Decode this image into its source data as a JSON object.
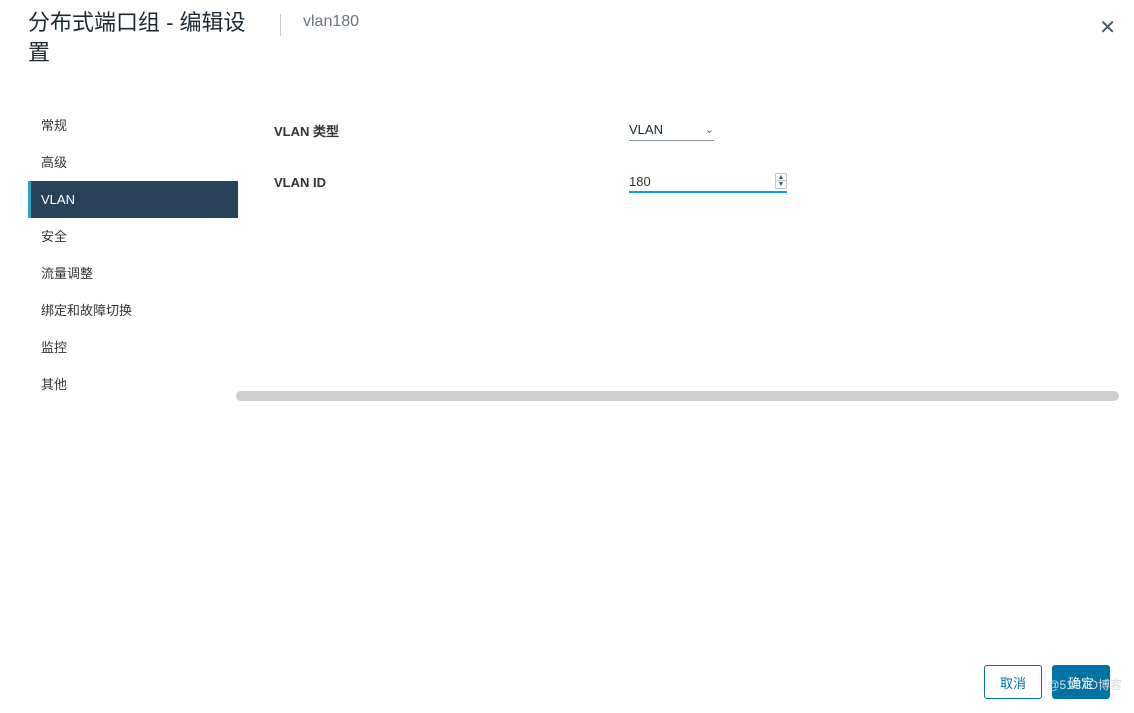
{
  "header": {
    "title": "分布式端口组 - 编辑设置",
    "subtitle": "vlan180"
  },
  "sidebar": {
    "items": [
      {
        "label": "常规",
        "active": false
      },
      {
        "label": "高级",
        "active": false
      },
      {
        "label": "VLAN",
        "active": true
      },
      {
        "label": "安全",
        "active": false
      },
      {
        "label": "流量调整",
        "active": false
      },
      {
        "label": "绑定和故障切换",
        "active": false
      },
      {
        "label": "监控",
        "active": false
      },
      {
        "label": "其他",
        "active": false
      }
    ]
  },
  "form": {
    "vlan_type_label": "VLAN 类型",
    "vlan_type_value": "VLAN",
    "vlan_id_label": "VLAN ID",
    "vlan_id_value": "180"
  },
  "footer": {
    "cancel": "取消",
    "ok": "确定"
  },
  "watermark": "@51CTO博客"
}
